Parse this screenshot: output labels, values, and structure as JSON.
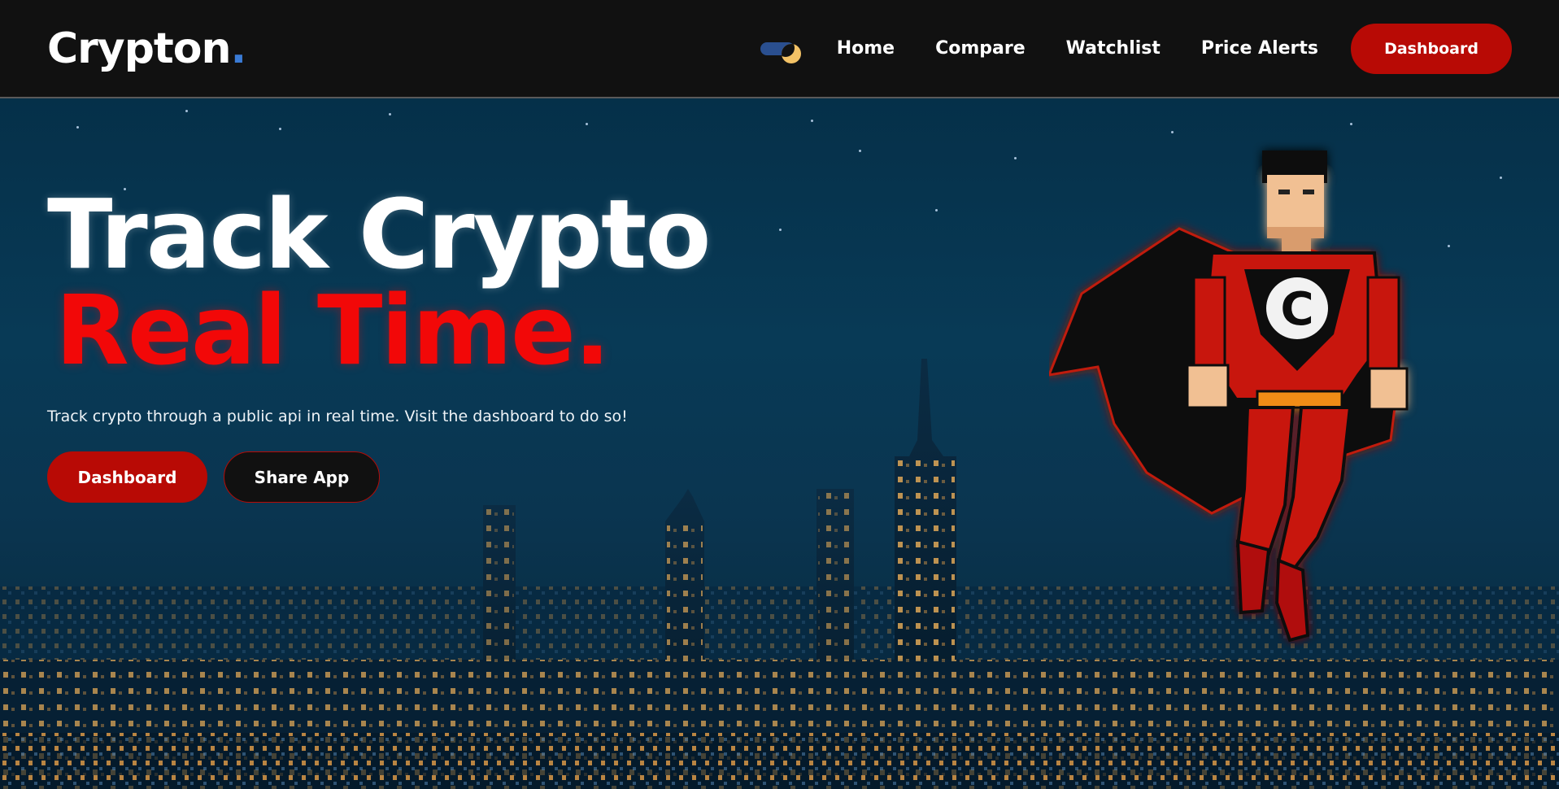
{
  "header": {
    "logo": {
      "text": "Crypton",
      "dot": "."
    },
    "theme_toggle": {
      "icon": "moon-icon",
      "mode": "dark"
    },
    "nav": [
      {
        "label": "Home"
      },
      {
        "label": "Compare"
      },
      {
        "label": "Watchlist"
      },
      {
        "label": "Price Alerts"
      }
    ],
    "cta_label": "Dashboard"
  },
  "hero": {
    "title_line1": "Track Crypto",
    "title_line2": "Real Time.",
    "subtitle": "Track crypto through a public api in real time. Visit the dashboard to do so!",
    "primary_button": "Dashboard",
    "secondary_button": "Share App",
    "mascot": {
      "emblem": "C",
      "icon": "superhero-mascot"
    }
  },
  "colors": {
    "accent_red": "#b80a05",
    "title_red": "#f20808",
    "logo_dot_blue": "#3a7bd5",
    "header_bg": "#111111",
    "hero_bg": "#083a56"
  }
}
